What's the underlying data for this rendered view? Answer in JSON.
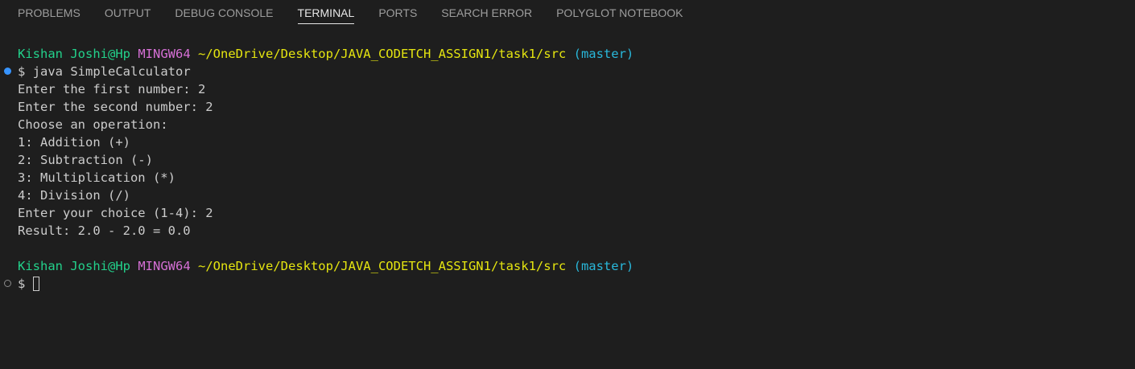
{
  "tabs": [
    {
      "label": "PROBLEMS"
    },
    {
      "label": "OUTPUT"
    },
    {
      "label": "DEBUG CONSOLE"
    },
    {
      "label": "TERMINAL",
      "active": true
    },
    {
      "label": "PORTS"
    },
    {
      "label": "SEARCH ERROR"
    },
    {
      "label": "POLYGLOT NOTEBOOK"
    }
  ],
  "prompt": {
    "user_host": "Kishan Joshi@Hp",
    "msys": "MINGW64",
    "path": "~/OneDrive/Desktop/JAVA_CODETCH_ASSIGN1/task1/src",
    "branch": "(master)",
    "symbol": "$"
  },
  "session": {
    "command": "java SimpleCalculator",
    "output": [
      "Enter the first number: 2",
      "Enter the second number: 2",
      "Choose an operation:",
      "1: Addition (+)",
      "2: Subtraction (-)",
      "3: Multiplication (*)",
      "4: Division (/)",
      "Enter your choice (1-4): 2",
      "Result: 2.0 - 2.0 = 0.0"
    ]
  },
  "colors": {
    "user": "#23d18b",
    "msys": "#d670d6",
    "path": "#e5e510",
    "branch": "#29b8db",
    "command_marker": "#3794ff"
  }
}
